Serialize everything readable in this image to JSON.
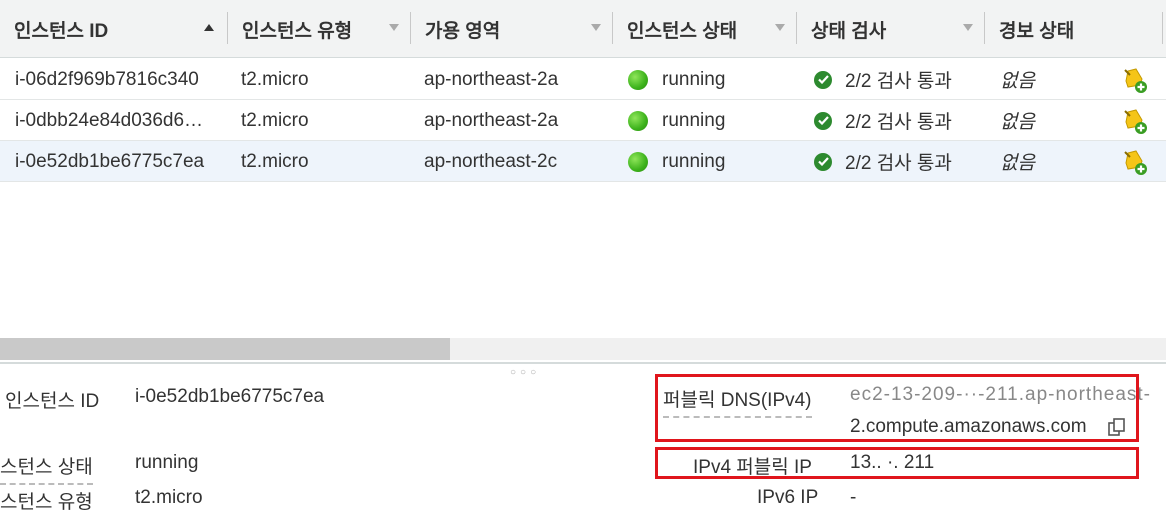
{
  "table": {
    "columns": [
      {
        "label": "인스턴스 ID",
        "sort": "asc"
      },
      {
        "label": "인스턴스 유형",
        "sort": "none"
      },
      {
        "label": "가용 영역",
        "sort": "none"
      },
      {
        "label": "인스턴스 상태",
        "sort": "none"
      },
      {
        "label": "상태 검사",
        "sort": "none"
      },
      {
        "label": "경보 상태",
        "sort": "none"
      }
    ],
    "rows": [
      {
        "id": "i-06d2f969b7816c340",
        "type": "t2.micro",
        "az": "ap-northeast-2a",
        "state": "running",
        "check": "2/2 검사 통과",
        "alarm": "없음"
      },
      {
        "id": "i-0dbb24e84d036d6…",
        "type": "t2.micro",
        "az": "ap-northeast-2a",
        "state": "running",
        "check": "2/2 검사 통과",
        "alarm": "없음"
      },
      {
        "id": "i-0e52db1be6775c7ea",
        "type": "t2.micro",
        "az": "ap-northeast-2c",
        "state": "running",
        "check": "2/2 검사 통과",
        "alarm": "없음"
      }
    ]
  },
  "details": {
    "instance_id_label": "인스턴스 ID",
    "instance_id_value": "i-0e52db1be6775c7ea",
    "instance_state_label": "스턴스 상태",
    "instance_state_value": "running",
    "instance_type_label": "스턴스 유형",
    "instance_type_value": "t2.micro",
    "public_dns_label": "퍼블릭 DNS(IPv4)",
    "public_dns_value_line1": "ec2-13-209-··-211.ap-northeast-",
    "public_dns_value_line2": "2.compute.amazonaws.com",
    "ipv4_public_ip_label": "IPv4 퍼블릭 IP",
    "ipv4_public_ip_value": "13.. ·. 211",
    "ipv6_ip_label": "IPv6 IP",
    "ipv6_ip_value": "-"
  },
  "colors": {
    "highlight_box": "#e0151c",
    "running_dot": "#3cb21b",
    "check_ok": "#2d8a2f"
  }
}
